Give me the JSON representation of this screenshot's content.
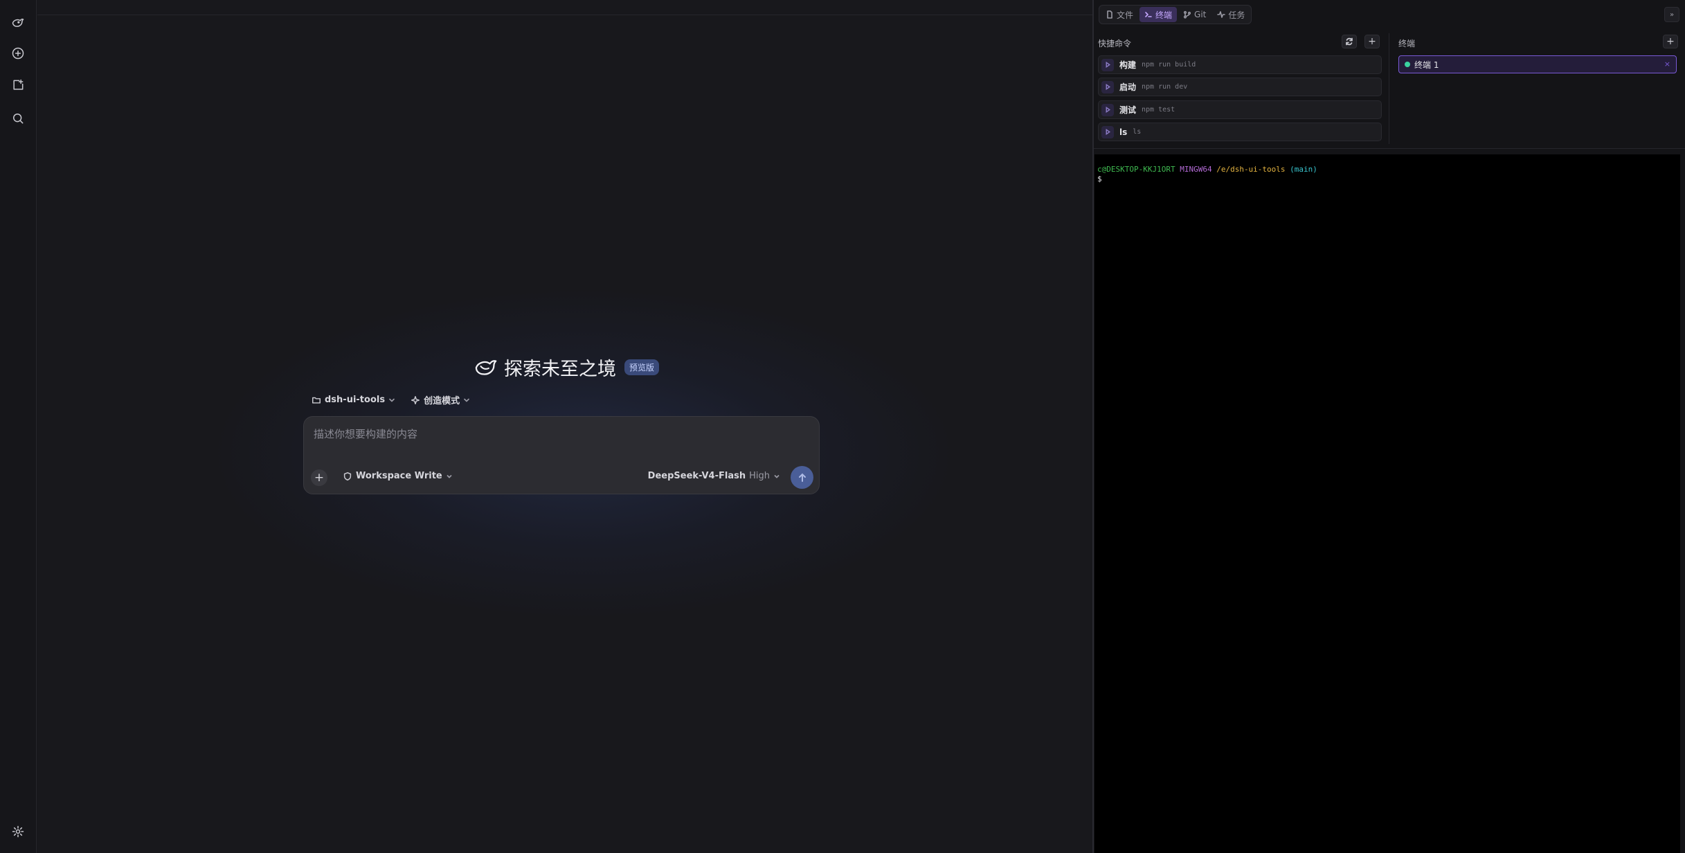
{
  "hero": {
    "title": "探索未至之境",
    "badge": "预览版"
  },
  "context": {
    "project": "dsh-ui-tools",
    "mode": "创造模式"
  },
  "composer": {
    "placeholder": "描述你想要构建的内容",
    "workspace": "Workspace Write",
    "model": "DeepSeek-V4-Flash",
    "level": "High"
  },
  "panel": {
    "tabs": [
      {
        "label": "文件",
        "icon": "file-icon"
      },
      {
        "label": "终端",
        "icon": "terminal-icon",
        "active": true
      },
      {
        "label": "Git",
        "icon": "git-icon"
      },
      {
        "label": "任务",
        "icon": "activity-icon"
      }
    ],
    "quick_commands": {
      "title": "快捷命令",
      "items": [
        {
          "name": "构建",
          "command": "npm run build"
        },
        {
          "name": "启动",
          "command": "npm run dev"
        },
        {
          "name": "测试",
          "command": "npm test"
        },
        {
          "name": "ls",
          "command": "ls"
        }
      ]
    },
    "terminals": {
      "title": "终端",
      "tabs": [
        {
          "label": "终端 1",
          "close": "×"
        }
      ]
    }
  },
  "terminal": {
    "user": "c@DESKTOP-KKJ1ORT",
    "system": "MINGW64",
    "path": "/e/dsh-ui-tools",
    "branch": "(main)",
    "prompt": "$"
  },
  "colors": {
    "accent": "#7a5ad8",
    "send": "#4a5e98",
    "active_tab": "#c6a8ff",
    "status_dot": "#3ad29f"
  }
}
